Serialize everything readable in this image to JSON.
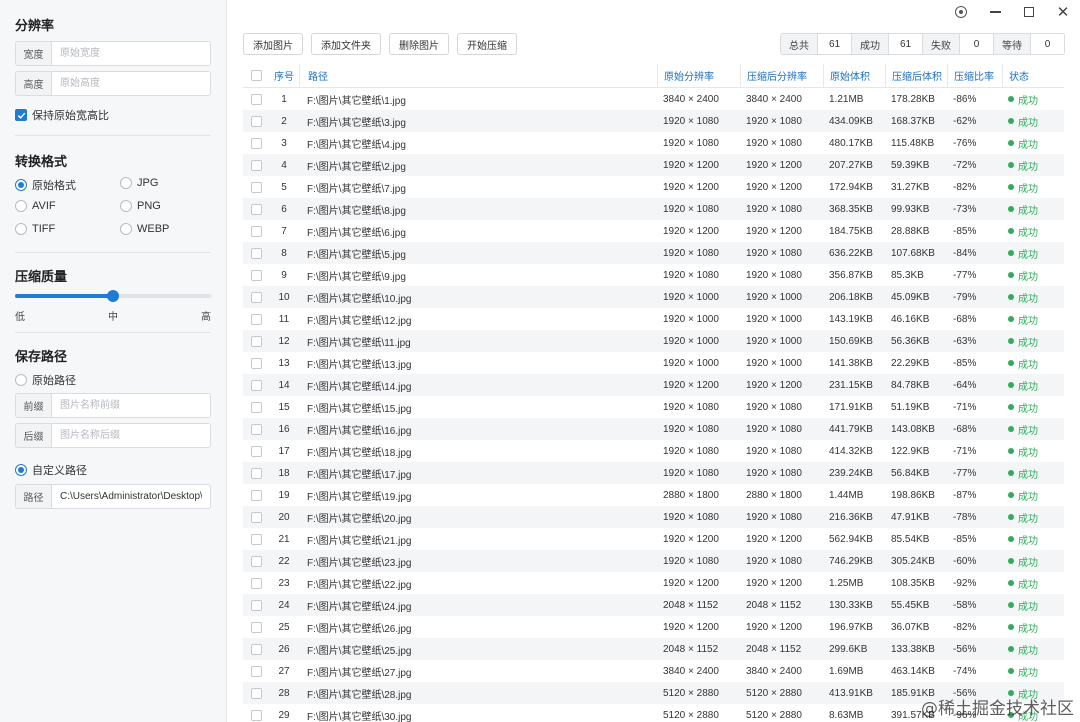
{
  "sidebar": {
    "resolution": {
      "title": "分辨率",
      "width_label": "宽度",
      "width_placeholder": "原始宽度",
      "height_label": "高度",
      "height_placeholder": "原始高度",
      "keep_ratio_label": "保持原始宽高比",
      "keep_ratio_checked": true
    },
    "format": {
      "title": "转换格式",
      "options": [
        {
          "label": "原始格式",
          "selected": true
        },
        {
          "label": "JPG",
          "selected": false
        },
        {
          "label": "AVIF",
          "selected": false
        },
        {
          "label": "PNG",
          "selected": false
        },
        {
          "label": "TIFF",
          "selected": false
        },
        {
          "label": "WEBP",
          "selected": false
        }
      ]
    },
    "quality": {
      "title": "压缩质量",
      "level": 0.5,
      "low": "低",
      "mid": "中",
      "high": "高"
    },
    "save": {
      "title": "保存路径",
      "original_label": "原始路径",
      "prefix_label": "前缀",
      "prefix_placeholder": "图片名称前缀",
      "suffix_label": "后缀",
      "suffix_placeholder": "图片名称后缀",
      "custom_label": "自定义路径",
      "path_label": "路径",
      "path_value": "C:\\Users\\Administrator\\Desktop\\"
    }
  },
  "toolbar": {
    "add_image": "添加图片",
    "add_folder": "添加文件夹",
    "remove_image": "删除图片",
    "start": "开始压缩"
  },
  "stats": {
    "total_label": "总共",
    "total": "61",
    "success_label": "成功",
    "success": "61",
    "fail_label": "失败",
    "fail": "0",
    "wait_label": "等待",
    "wait": "0"
  },
  "table": {
    "headers": {
      "index": "序号",
      "path": "路径",
      "orig_res": "原始分辨率",
      "comp_res": "压缩后分辨率",
      "orig_size": "原始体积",
      "comp_size": "压缩后体积",
      "ratio": "压缩比率",
      "status": "状态"
    },
    "rows": [
      {
        "idx": "1",
        "path": "F:\\图片\\其它壁纸\\1.jpg",
        "ores": "3840 × 2400",
        "cres": "3840 × 2400",
        "osz": "1.21MB",
        "csz": "178.28KB",
        "ratio": "-86%",
        "status": "成功"
      },
      {
        "idx": "2",
        "path": "F:\\图片\\其它壁纸\\3.jpg",
        "ores": "1920 × 1080",
        "cres": "1920 × 1080",
        "osz": "434.09KB",
        "csz": "168.37KB",
        "ratio": "-62%",
        "status": "成功"
      },
      {
        "idx": "3",
        "path": "F:\\图片\\其它壁纸\\4.jpg",
        "ores": "1920 × 1080",
        "cres": "1920 × 1080",
        "osz": "480.17KB",
        "csz": "115.48KB",
        "ratio": "-76%",
        "status": "成功"
      },
      {
        "idx": "4",
        "path": "F:\\图片\\其它壁纸\\2.jpg",
        "ores": "1920 × 1200",
        "cres": "1920 × 1200",
        "osz": "207.27KB",
        "csz": "59.39KB",
        "ratio": "-72%",
        "status": "成功"
      },
      {
        "idx": "5",
        "path": "F:\\图片\\其它壁纸\\7.jpg",
        "ores": "1920 × 1200",
        "cres": "1920 × 1200",
        "osz": "172.94KB",
        "csz": "31.27KB",
        "ratio": "-82%",
        "status": "成功"
      },
      {
        "idx": "6",
        "path": "F:\\图片\\其它壁纸\\8.jpg",
        "ores": "1920 × 1080",
        "cres": "1920 × 1080",
        "osz": "368.35KB",
        "csz": "99.93KB",
        "ratio": "-73%",
        "status": "成功"
      },
      {
        "idx": "7",
        "path": "F:\\图片\\其它壁纸\\6.jpg",
        "ores": "1920 × 1200",
        "cres": "1920 × 1200",
        "osz": "184.75KB",
        "csz": "28.88KB",
        "ratio": "-85%",
        "status": "成功"
      },
      {
        "idx": "8",
        "path": "F:\\图片\\其它壁纸\\5.jpg",
        "ores": "1920 × 1080",
        "cres": "1920 × 1080",
        "osz": "636.22KB",
        "csz": "107.68KB",
        "ratio": "-84%",
        "status": "成功"
      },
      {
        "idx": "9",
        "path": "F:\\图片\\其它壁纸\\9.jpg",
        "ores": "1920 × 1080",
        "cres": "1920 × 1080",
        "osz": "356.87KB",
        "csz": "85.3KB",
        "ratio": "-77%",
        "status": "成功"
      },
      {
        "idx": "10",
        "path": "F:\\图片\\其它壁纸\\10.jpg",
        "ores": "1920 × 1000",
        "cres": "1920 × 1000",
        "osz": "206.18KB",
        "csz": "45.09KB",
        "ratio": "-79%",
        "status": "成功"
      },
      {
        "idx": "11",
        "path": "F:\\图片\\其它壁纸\\12.jpg",
        "ores": "1920 × 1000",
        "cres": "1920 × 1000",
        "osz": "143.19KB",
        "csz": "46.16KB",
        "ratio": "-68%",
        "status": "成功"
      },
      {
        "idx": "12",
        "path": "F:\\图片\\其它壁纸\\11.jpg",
        "ores": "1920 × 1000",
        "cres": "1920 × 1000",
        "osz": "150.69KB",
        "csz": "56.36KB",
        "ratio": "-63%",
        "status": "成功"
      },
      {
        "idx": "13",
        "path": "F:\\图片\\其它壁纸\\13.jpg",
        "ores": "1920 × 1000",
        "cres": "1920 × 1000",
        "osz": "141.38KB",
        "csz": "22.29KB",
        "ratio": "-85%",
        "status": "成功"
      },
      {
        "idx": "14",
        "path": "F:\\图片\\其它壁纸\\14.jpg",
        "ores": "1920 × 1200",
        "cres": "1920 × 1200",
        "osz": "231.15KB",
        "csz": "84.78KB",
        "ratio": "-64%",
        "status": "成功"
      },
      {
        "idx": "15",
        "path": "F:\\图片\\其它壁纸\\15.jpg",
        "ores": "1920 × 1080",
        "cres": "1920 × 1080",
        "osz": "171.91KB",
        "csz": "51.19KB",
        "ratio": "-71%",
        "status": "成功"
      },
      {
        "idx": "16",
        "path": "F:\\图片\\其它壁纸\\16.jpg",
        "ores": "1920 × 1080",
        "cres": "1920 × 1080",
        "osz": "441.79KB",
        "csz": "143.08KB",
        "ratio": "-68%",
        "status": "成功"
      },
      {
        "idx": "17",
        "path": "F:\\图片\\其它壁纸\\18.jpg",
        "ores": "1920 × 1080",
        "cres": "1920 × 1080",
        "osz": "414.32KB",
        "csz": "122.9KB",
        "ratio": "-71%",
        "status": "成功"
      },
      {
        "idx": "18",
        "path": "F:\\图片\\其它壁纸\\17.jpg",
        "ores": "1920 × 1080",
        "cres": "1920 × 1080",
        "osz": "239.24KB",
        "csz": "56.84KB",
        "ratio": "-77%",
        "status": "成功"
      },
      {
        "idx": "19",
        "path": "F:\\图片\\其它壁纸\\19.jpg",
        "ores": "2880 × 1800",
        "cres": "2880 × 1800",
        "osz": "1.44MB",
        "csz": "198.86KB",
        "ratio": "-87%",
        "status": "成功"
      },
      {
        "idx": "20",
        "path": "F:\\图片\\其它壁纸\\20.jpg",
        "ores": "1920 × 1080",
        "cres": "1920 × 1080",
        "osz": "216.36KB",
        "csz": "47.91KB",
        "ratio": "-78%",
        "status": "成功"
      },
      {
        "idx": "21",
        "path": "F:\\图片\\其它壁纸\\21.jpg",
        "ores": "1920 × 1200",
        "cres": "1920 × 1200",
        "osz": "562.94KB",
        "csz": "85.54KB",
        "ratio": "-85%",
        "status": "成功"
      },
      {
        "idx": "22",
        "path": "F:\\图片\\其它壁纸\\23.jpg",
        "ores": "1920 × 1080",
        "cres": "1920 × 1080",
        "osz": "746.29KB",
        "csz": "305.24KB",
        "ratio": "-60%",
        "status": "成功"
      },
      {
        "idx": "23",
        "path": "F:\\图片\\其它壁纸\\22.jpg",
        "ores": "1920 × 1200",
        "cres": "1920 × 1200",
        "osz": "1.25MB",
        "csz": "108.35KB",
        "ratio": "-92%",
        "status": "成功"
      },
      {
        "idx": "24",
        "path": "F:\\图片\\其它壁纸\\24.jpg",
        "ores": "2048 × 1152",
        "cres": "2048 × 1152",
        "osz": "130.33KB",
        "csz": "55.45KB",
        "ratio": "-58%",
        "status": "成功"
      },
      {
        "idx": "25",
        "path": "F:\\图片\\其它壁纸\\26.jpg",
        "ores": "1920 × 1200",
        "cres": "1920 × 1200",
        "osz": "196.97KB",
        "csz": "36.07KB",
        "ratio": "-82%",
        "status": "成功"
      },
      {
        "idx": "26",
        "path": "F:\\图片\\其它壁纸\\25.jpg",
        "ores": "2048 × 1152",
        "cres": "2048 × 1152",
        "osz": "299.6KB",
        "csz": "133.38KB",
        "ratio": "-56%",
        "status": "成功"
      },
      {
        "idx": "27",
        "path": "F:\\图片\\其它壁纸\\27.jpg",
        "ores": "3840 × 2400",
        "cres": "3840 × 2400",
        "osz": "1.69MB",
        "csz": "463.14KB",
        "ratio": "-74%",
        "status": "成功"
      },
      {
        "idx": "28",
        "path": "F:\\图片\\其它壁纸\\28.jpg",
        "ores": "5120 × 2880",
        "cres": "5120 × 2880",
        "osz": "413.91KB",
        "csz": "185.91KB",
        "ratio": "-56%",
        "status": "成功"
      },
      {
        "idx": "29",
        "path": "F:\\图片\\其它壁纸\\30.jpg",
        "ores": "5120 × 2880",
        "cres": "5120 × 2880",
        "osz": "8.63MB",
        "csz": "391.57KB",
        "ratio": "-96%",
        "status": "成功"
      }
    ]
  },
  "watermark": "@稀土掘金技术社区",
  "colors": {
    "accent": "#1e7cd6",
    "success": "#2fae5a",
    "header_text": "#1e6fc0"
  }
}
